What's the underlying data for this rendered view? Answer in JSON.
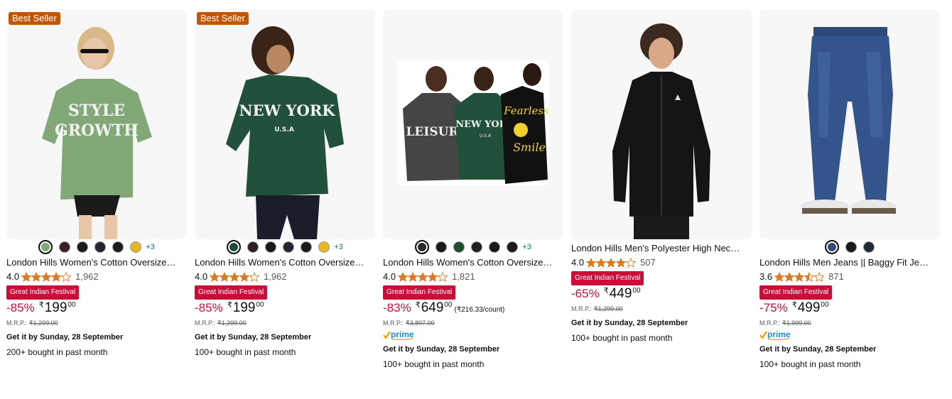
{
  "labels": {
    "mrp": "M.R.P.:",
    "currency": "₹",
    "prime": "prime"
  },
  "colors": {
    "deal_red": "#cc0c39",
    "best_seller_orange": "#c45500",
    "star_orange": "#de7921",
    "link_teal": "#007185",
    "prime_blue": "#1b8ee0"
  },
  "products": [
    {
      "badge": "Best Seller",
      "title": "London Hills Women's Cotton Oversized...",
      "rating": "4.0",
      "stars": 4,
      "review_count": "1,962",
      "deal_label": "Great Indian Festival",
      "discount": "-85%",
      "price_whole": "199",
      "price_fraction": "00",
      "unit_price": "",
      "mrp": "₹1,299.00",
      "prime": false,
      "delivery": "Get it by Sunday, 28 September",
      "bought": "200+ bought in past month",
      "more_colors": "+3",
      "swatches": [
        "#7ea86e",
        "#3a1f2b",
        "#1a1a1a",
        "#2a2230",
        "#1c1c1c",
        "#e8b822"
      ],
      "image_icon": "green-tshirt-woman-icon"
    },
    {
      "badge": "Best Seller",
      "title": "London Hills Women's Cotton Oversized...",
      "rating": "4.0",
      "stars": 4,
      "review_count": "1,962",
      "deal_label": "Great Indian Festival",
      "discount": "-85%",
      "price_whole": "199",
      "price_fraction": "00",
      "unit_price": "",
      "mrp": "₹1,299.00",
      "prime": false,
      "delivery": "Get it by Sunday, 28 September",
      "bought": "100+ bought in past month",
      "more_colors": "+3",
      "swatches": [
        "#1f4d36",
        "#2e1c26",
        "#1a1a1a",
        "#2a2230",
        "#1c1c1c",
        "#e8b822"
      ],
      "image_icon": "dark-green-tshirt-woman-icon"
    },
    {
      "badge": "",
      "title": "London Hills Women's Cotton Oversized...",
      "rating": "4.0",
      "stars": 4,
      "review_count": "1,821",
      "deal_label": "Great Indian Festival",
      "discount": "-83%",
      "price_whole": "649",
      "price_fraction": "00",
      "unit_price": "(₹216.33/count)",
      "mrp": "₹3,897.00",
      "prime": true,
      "delivery": "Get it by Sunday, 28 September",
      "bought": "100+ bought in past month",
      "more_colors": "+3",
      "swatches": [
        "#2a2a2a",
        "#1a1a1a",
        "#1f4d36",
        "#222222",
        "#1a1a1a",
        "#1a1a1a"
      ],
      "image_icon": "three-tshirts-combo-icon"
    },
    {
      "badge": "",
      "title": "London Hills Men's Polyester High Neck...",
      "rating": "4.0",
      "stars": 4,
      "review_count": "507",
      "deal_label": "Great Indian Festival",
      "discount": "-65%",
      "price_whole": "449",
      "price_fraction": "00",
      "unit_price": "",
      "mrp": "₹1,299.00",
      "prime": false,
      "delivery": "Get it by Sunday, 28 September",
      "bought": "100+ bought in past month",
      "more_colors": "",
      "swatches": [],
      "image_icon": "black-jacket-man-icon"
    },
    {
      "badge": "",
      "title": "London Hills Men Jeans || Baggy Fit Jean's...",
      "rating": "3.6",
      "stars": 3.5,
      "review_count": "871",
      "deal_label": "Great Indian Festival",
      "discount": "-75%",
      "price_whole": "499",
      "price_fraction": "00",
      "unit_price": "",
      "mrp": "₹1,999.00",
      "prime": true,
      "delivery": "Get it by Sunday, 28 September",
      "bought": "100+ bought in past month",
      "more_colors": "",
      "swatches": [
        "#3a4a78",
        "#1a1a1a",
        "#1e2a36"
      ],
      "image_icon": "blue-jeans-man-icon"
    }
  ]
}
